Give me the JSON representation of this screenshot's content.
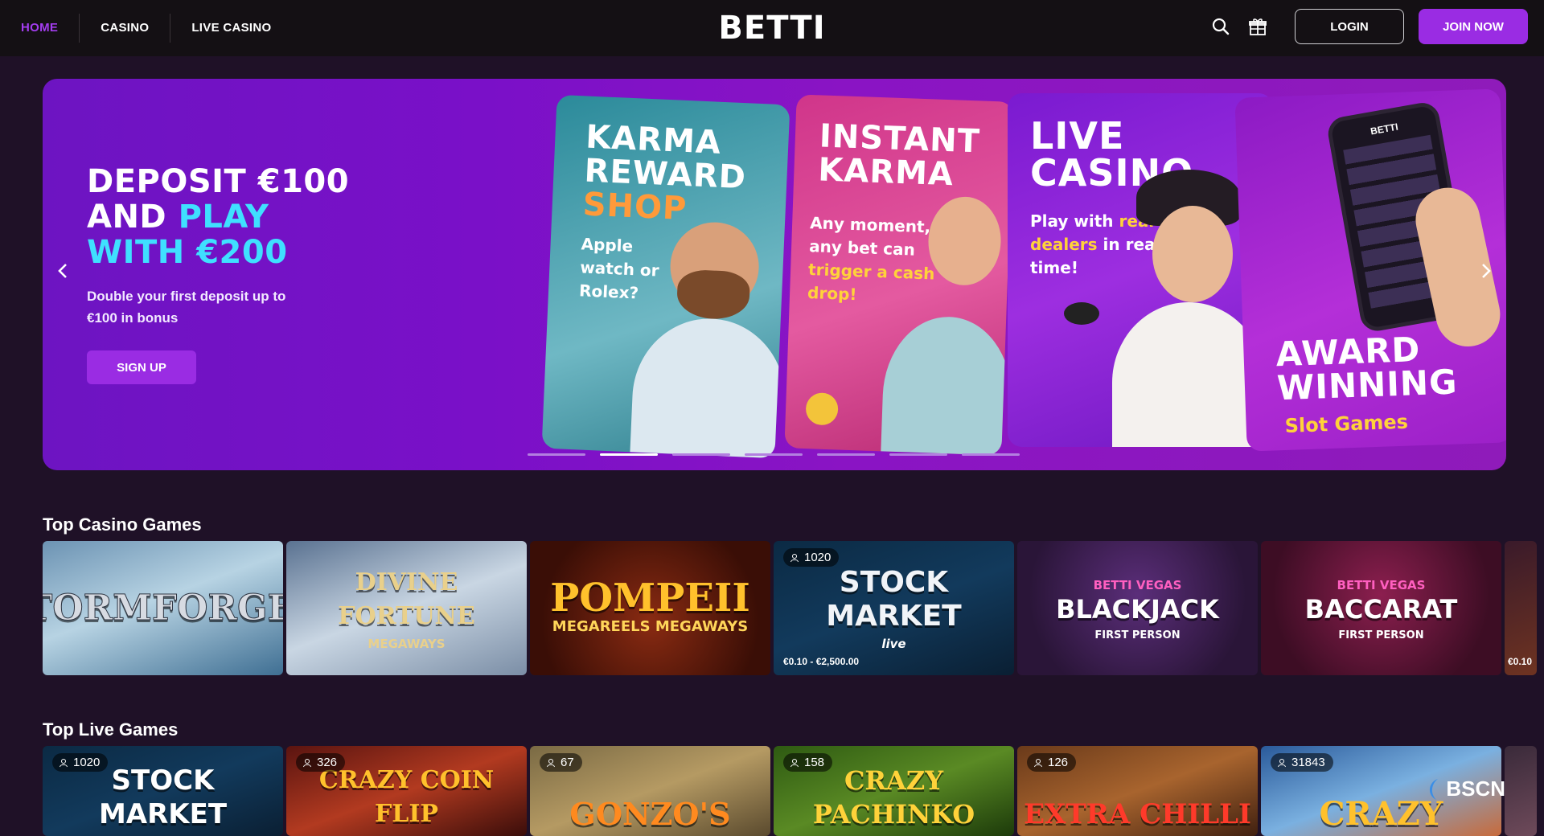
{
  "header": {
    "nav": [
      "HOME",
      "CASINO",
      "LIVE CASINO"
    ],
    "logo": "BETTI",
    "login": "LOGIN",
    "join": "JOIN NOW"
  },
  "hero": {
    "title_line1": "DEPOSIT €100",
    "title_line2_a": "AND ",
    "title_line2_b": "PLAY",
    "title_line3": "WITH €200",
    "subtitle": "Double your first deposit up to €100 in bonus",
    "cta": "SIGN UP",
    "slides": 7,
    "active_slide": 1,
    "cards": [
      {
        "title_lines": [
          "KARMA",
          "REWARD",
          "SHOP"
        ],
        "text": "Apple watch or Rolex?"
      },
      {
        "title_lines": [
          "INSTANT",
          "KARMA"
        ],
        "text_a": "Any moment, any bet can ",
        "text_b": "trigger a cash drop!"
      },
      {
        "title_lines": [
          "LIVE",
          "CASINO"
        ],
        "text_a": "Play with ",
        "text_b": "real dealers",
        "text_c": " in real time!"
      },
      {
        "title_lines": [
          "AWARD",
          "WINNING"
        ],
        "subtitle": "Slot Games",
        "phone_logo": "BETTI"
      }
    ]
  },
  "top_casino": {
    "title": "Top Casino Games",
    "games": [
      {
        "name": "STORMFORGED"
      },
      {
        "name": "DIVINE FORTUNE",
        "sub": "MEGAWAYS"
      },
      {
        "name": "POMPEII",
        "sub": "MEGAREELS MEGAWAYS"
      },
      {
        "name": "STOCK MARKET",
        "sub": "live",
        "players": "1020",
        "limits": "€0.10 - €2,500.00"
      },
      {
        "brand": "BETTI VEGAS",
        "name": "BLACKJACK",
        "sub": "FIRST PERSON"
      },
      {
        "brand": "BETTI VEGAS",
        "name": "BACCARAT",
        "sub": "FIRST PERSON"
      }
    ],
    "partial_limits": "€0.10"
  },
  "top_live": {
    "title": "Top Live Games",
    "games": [
      {
        "name": "STOCK MARKET",
        "players": "1020"
      },
      {
        "name": "CRAZY COIN FLIP",
        "players": "326"
      },
      {
        "name": "GONZO'S",
        "players": "67"
      },
      {
        "name": "CRAZY PACHINKO",
        "players": "158"
      },
      {
        "name": "EXTRA CHILLI",
        "players": "126"
      },
      {
        "name": "CRAZY",
        "players": "31843"
      }
    ]
  },
  "watermark": "BSCN",
  "colors": {
    "accent": "#9a2ce3",
    "cyan": "#3fe0ff",
    "background": "#1f1127"
  }
}
